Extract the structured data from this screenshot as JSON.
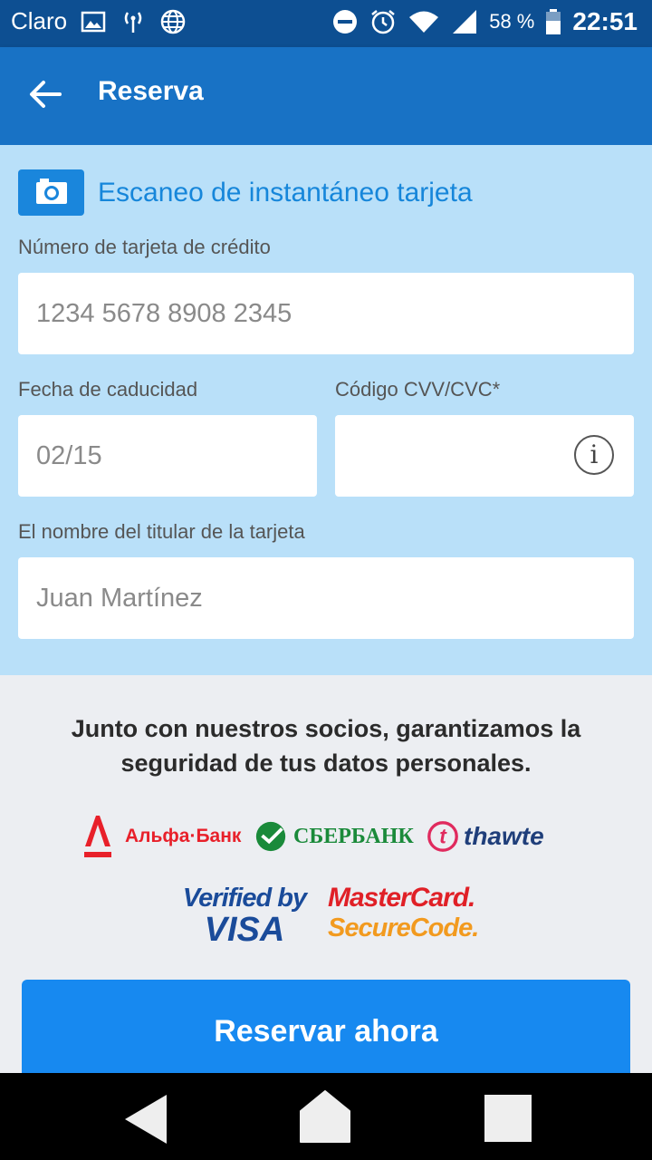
{
  "status_bar": {
    "carrier": "Claro",
    "battery": "58 %",
    "time": "22:51"
  },
  "app_bar": {
    "title": "Reserva"
  },
  "card_form": {
    "scan_label": "Escaneo de instantáneo tarjeta",
    "card_number_label": "Número de tarjeta de crédito",
    "card_number_placeholder": "1234 5678 8908 2345",
    "expiry_label": "Fecha de caducidad",
    "expiry_placeholder": "02/15",
    "cvv_label": "Código CVV/CVC*",
    "cvv_value": "",
    "holder_label": "El nombre del titular de la tarjeta",
    "holder_placeholder": "Juan Martínez"
  },
  "security": {
    "text": "Junto con nuestros socios, garantizamos la seguridad de tus datos personales.",
    "partners": {
      "alfa": "Альфа·Банк",
      "sber": "СБЕРБАНК",
      "thawte": "thawte",
      "visa_line1": "Verified by",
      "visa_line2": "VISA",
      "mc_line1": "MasterCard.",
      "mc_line2": "SecureCode."
    }
  },
  "cta": {
    "label": "Reservar ahora"
  },
  "colors": {
    "status_bar": "#0d4f92",
    "app_bar": "#1872c5",
    "panel": "#b9e0f9",
    "accent": "#1789f0",
    "background": "#eceef2"
  },
  "icons": [
    "image-icon",
    "signal-tower-icon",
    "globe-icon",
    "dnd-icon",
    "alarm-icon",
    "wifi-icon",
    "cell-signal-icon",
    "battery-icon",
    "back-arrow-icon",
    "camera-icon",
    "info-icon",
    "nav-back-icon",
    "nav-home-icon",
    "nav-recents-icon"
  ]
}
